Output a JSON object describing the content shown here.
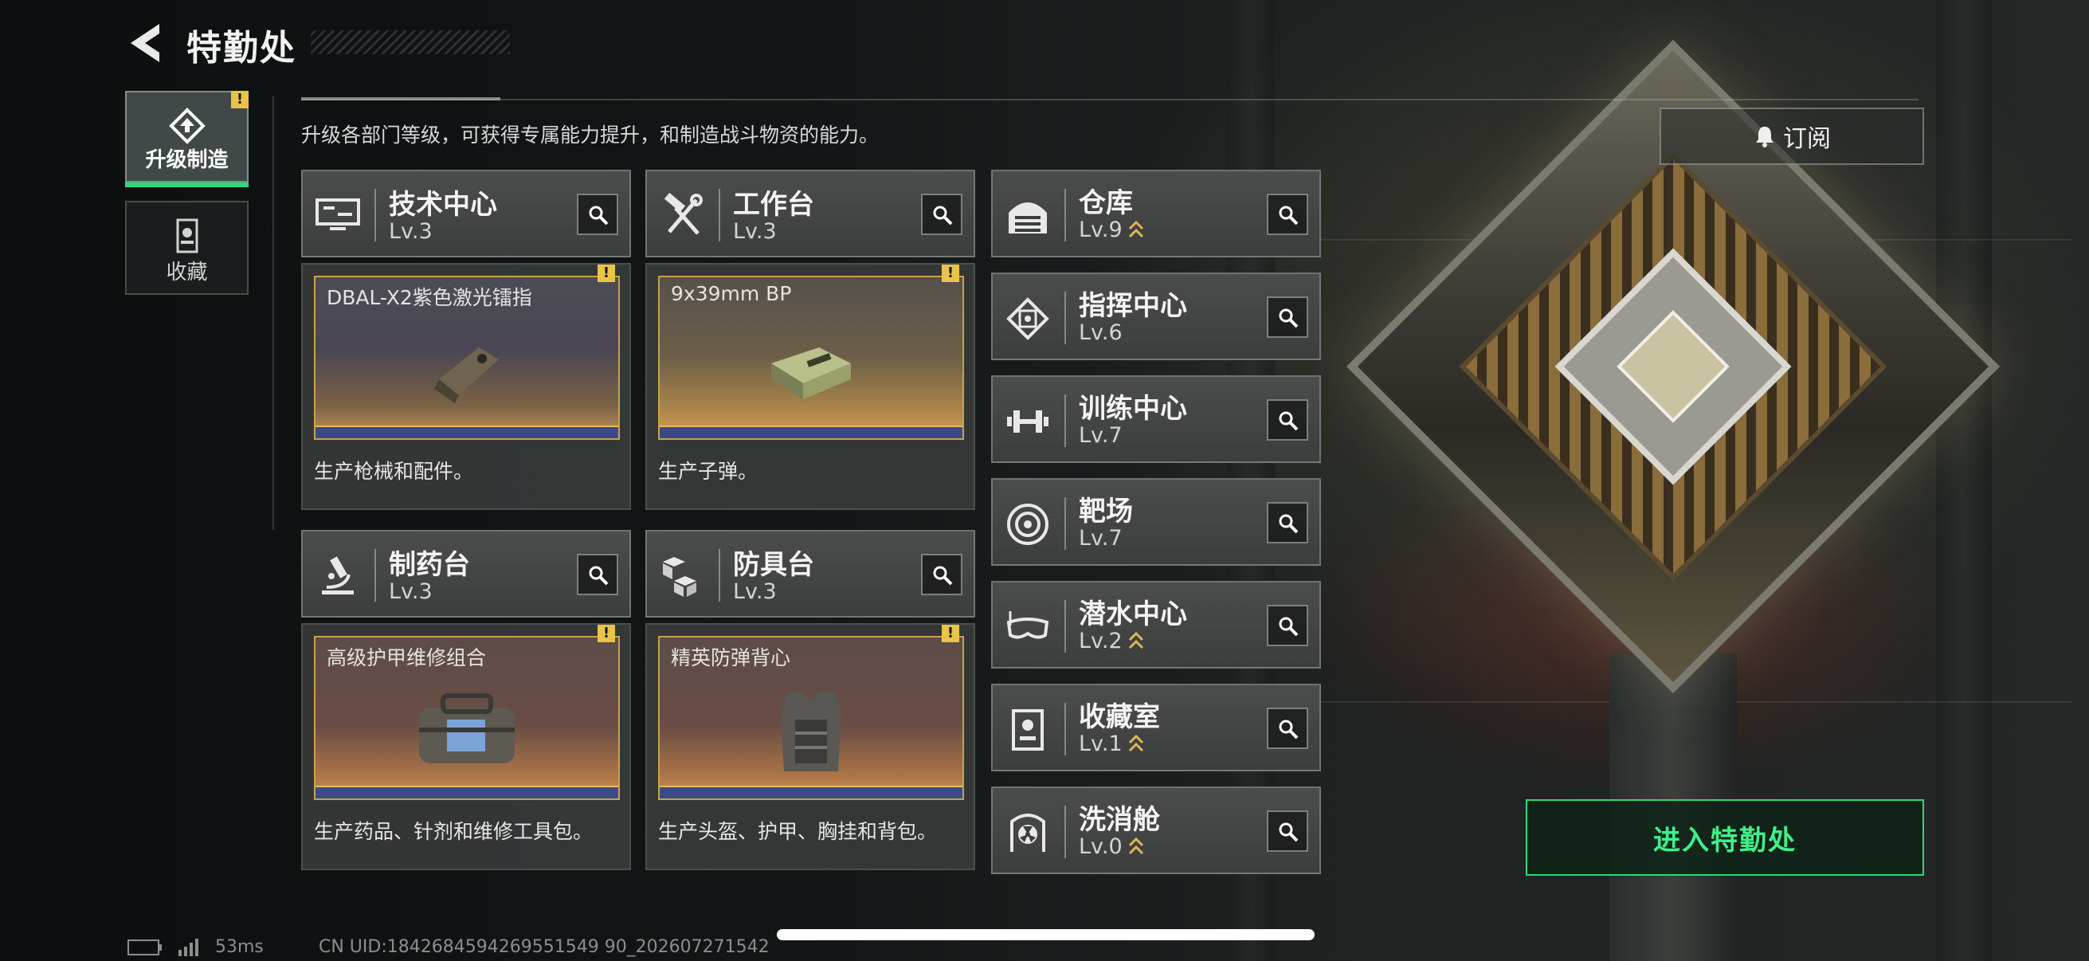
{
  "header": {
    "title": "特勤处"
  },
  "tabs": [
    {
      "label": "升级制造",
      "active": true,
      "alert": "!"
    },
    {
      "label": "收藏",
      "active": false
    }
  ],
  "subtitle": "升级各部门等级，可获得专属能力提升，和制造战斗物资的能力。",
  "subscribe_label": "订阅",
  "production_cards": [
    {
      "name": "技术中心",
      "level": "Lv.3",
      "icon": "computer-icon",
      "product": "DBAL-X2紫色激光镭指",
      "alert": "!",
      "desc": "生产枪械和配件。"
    },
    {
      "name": "工作台",
      "level": "Lv.3",
      "icon": "hammer-wrench-icon",
      "product": "9x39mm BP",
      "alert": "!",
      "desc": "生产子弹。"
    },
    {
      "name": "制药台",
      "level": "Lv.3",
      "icon": "microscope-icon",
      "product": "高级护甲维修组合",
      "alert": "!",
      "desc": "生产药品、针剂和维修工具包。"
    },
    {
      "name": "防具台",
      "level": "Lv.3",
      "icon": "cubes-icon",
      "product": "精英防弹背心",
      "alert": "!",
      "desc": "生产头盔、护甲、胸挂和背包。"
    }
  ],
  "facilities": [
    {
      "name": "仓库",
      "level": "Lv.9",
      "upgradable": true,
      "icon": "warehouse-icon"
    },
    {
      "name": "指挥中心",
      "level": "Lv.6",
      "upgradable": false,
      "icon": "chip-icon"
    },
    {
      "name": "训练中心",
      "level": "Lv.7",
      "upgradable": false,
      "icon": "dumbbell-icon"
    },
    {
      "name": "靶场",
      "level": "Lv.7",
      "upgradable": false,
      "icon": "target-icon"
    },
    {
      "name": "潜水中心",
      "level": "Lv.2",
      "upgradable": true,
      "icon": "dive-mask-icon"
    },
    {
      "name": "收藏室",
      "level": "Lv.1",
      "upgradable": true,
      "icon": "collection-icon"
    },
    {
      "name": "洗消舱",
      "level": "Lv.0",
      "upgradable": true,
      "icon": "radiation-icon"
    }
  ],
  "enter_button": "进入特勤处",
  "status": {
    "ping": "53ms",
    "uid": "CN UID:1842684594269551549 90_202607271542"
  },
  "colors": {
    "accent": "#2fd877",
    "alert": "#e9c44a",
    "upgrade_arrow": "#e0b656"
  }
}
